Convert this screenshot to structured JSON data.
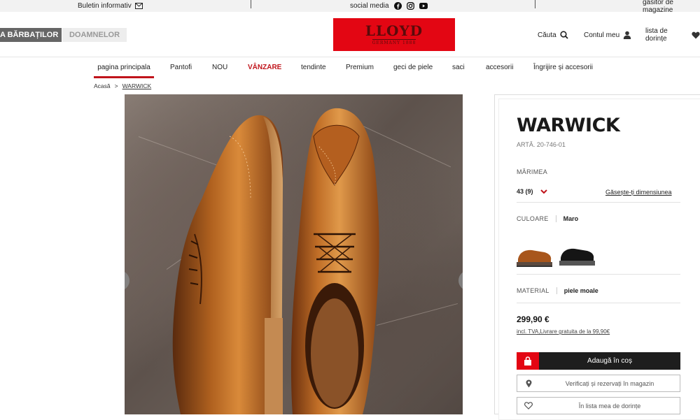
{
  "topbar": {
    "newsletter": "Buletin informativ",
    "social": "social media",
    "store_finder": "găsitor de magazine"
  },
  "header": {
    "tab_men": "A BĂRBAȚILOR",
    "tab_women": "DOAMNELOR",
    "logo_word": "LLOYD",
    "logo_sub": "GERMANY 1888",
    "search": "Căuta",
    "account": "Contul meu",
    "wishlist": "lista de dorințe"
  },
  "nav": {
    "items": [
      "pagina principala",
      "Pantofi",
      "NOU",
      "VÂNZARE",
      "tendinte",
      "Premium",
      "geci de piele",
      "saci",
      "accesorii",
      "Îngrijire și accesorii"
    ]
  },
  "breadcrumb": {
    "home": "Acasă",
    "sep": ">",
    "current": "WARWICK"
  },
  "product": {
    "name": "WARWICK",
    "article": "ARTĂ. 20-746-01",
    "size_label": "MĂRIMEA",
    "size_value": "43 (9)",
    "size_link": "Găsește-ți dimensiunea",
    "color_label": "CULOARE",
    "color_value": "Maro",
    "material_label": "MATERIAL",
    "material_value": "piele moale",
    "price": "299,90 €",
    "price_note": "incl. TVA,Livrare gratuita de la 99,90€",
    "add_to_cart": "Adaugă în coș",
    "check_store": "Verificați și rezervați în magazin",
    "wishlist_btn": "În lista mea de dorințe"
  },
  "colors": {
    "accent": "#c0141b",
    "brand": "#e30613",
    "dark": "#1e1e1e"
  }
}
